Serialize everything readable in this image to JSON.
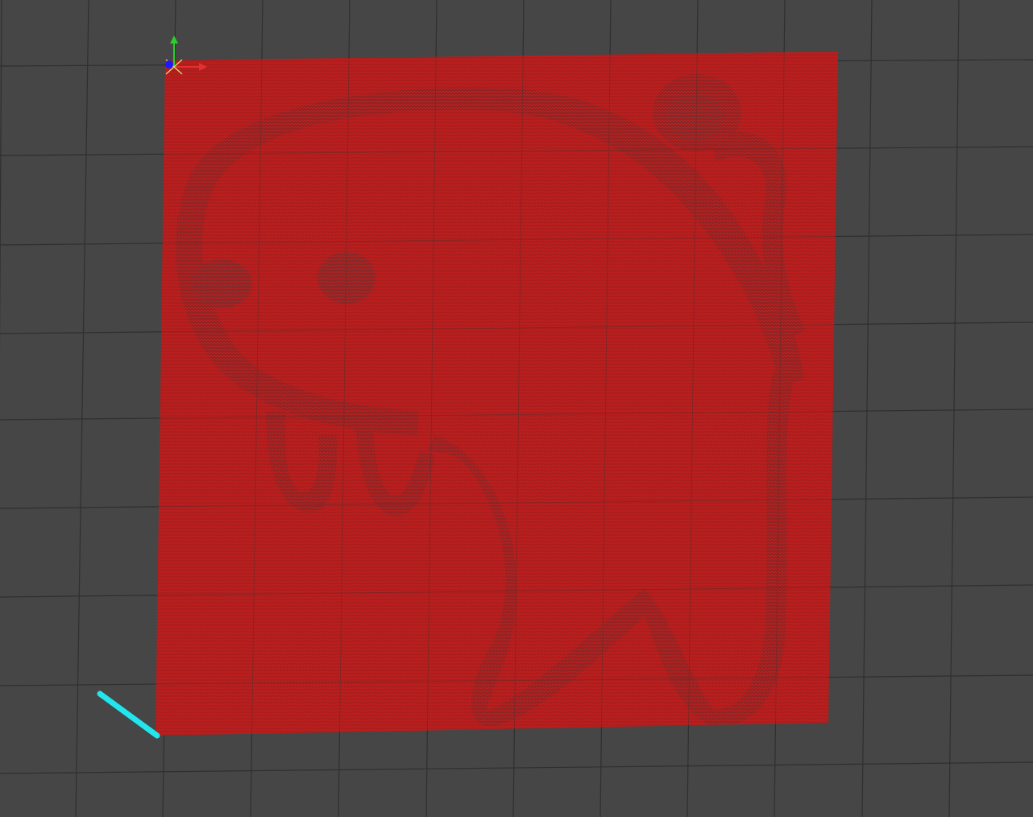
{
  "viewport": {
    "name": "3d-viewport",
    "background_color": "#464646",
    "grid_color": "#2f2f2f"
  },
  "point_cloud": {
    "mark_color": "#c81e1e",
    "base_color": "#a81e1e",
    "relief_color": "#8a2424"
  },
  "axis_gizmo": {
    "x_color": "#e53030",
    "y_color": "#2ecc2e",
    "z_color": "#1a1aff"
  },
  "laser_line": {
    "color": "#22e6ee"
  }
}
